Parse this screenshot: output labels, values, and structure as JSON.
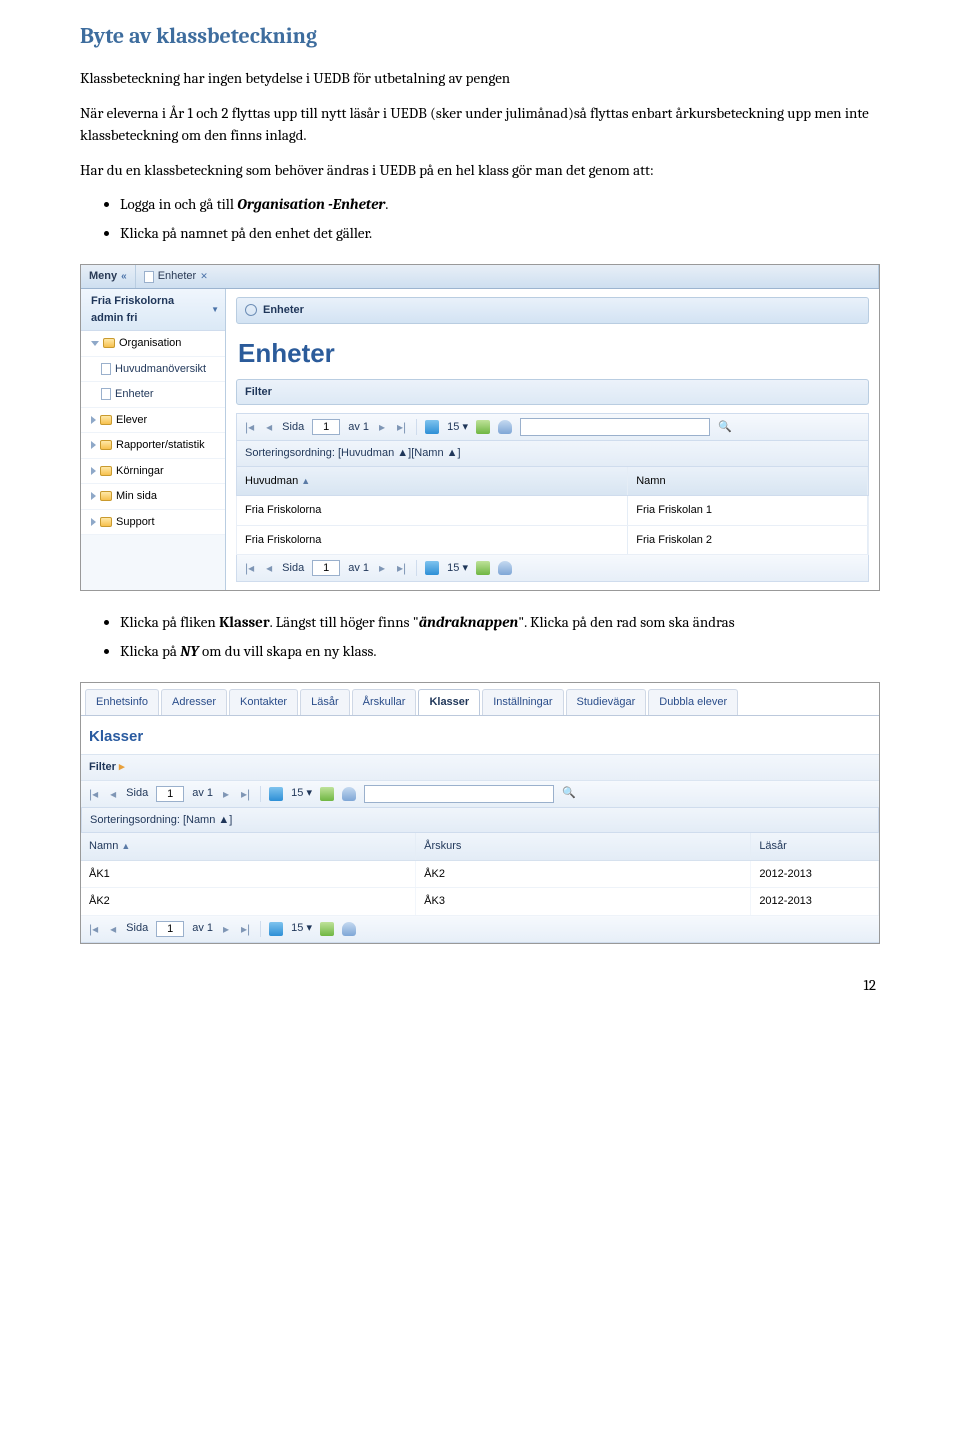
{
  "doc": {
    "heading": "Byte av klassbeteckning",
    "p1": "Klassbeteckning har ingen betydelse i UEDB för utbetalning av pengen",
    "p2a": "När eleverna i År 1 och 2 flyttas upp till nytt läsår i UEDB (sker under julimånad)så flyttas enbart årkursbeteckning upp men inte klassbeteckning om den finns inlagd.",
    "p3": "Har du en klassbeteckning som behöver ändras i UEDB på en hel klass gör man det genom att:",
    "b1a": "Logga in och gå till ",
    "b1b": "Organisation -Enheter",
    "b1c": ".",
    "b2": "Klicka på namnet på den enhet det gäller.",
    "c1a": "Klicka på fliken ",
    "c1b": "Klasser",
    "c1c": ". Längst till höger finns \"",
    "c1d": "ändraknappen",
    "c1e": "\". Klicka på den rad som ska ändras",
    "c2a": "Klicka på ",
    "c2b": "NY",
    "c2c": " om du vill skapa en ny klass.",
    "page": "12"
  },
  "s1": {
    "meny": "Meny",
    "tab": "Enheter",
    "user": "Fria Friskolorna admin fri",
    "side": {
      "org": "Organisation",
      "huvud": "Huvudmanöversikt",
      "enheter": "Enheter",
      "elever": "Elever",
      "rapport": "Rapporter/statistik",
      "korn": "Körningar",
      "minsida": "Min sida",
      "support": "Support"
    },
    "panel": "Enheter",
    "title": "Enheter",
    "filter": "Filter",
    "sida": "Sida",
    "av": "av 1",
    "perpage": "15",
    "sort": "Sorteringsordning: [Huvudman ▲][Namn ▲]",
    "col_huvudman": "Huvudman",
    "col_namn": "Namn",
    "rows": [
      {
        "h": "Fria Friskolorna",
        "n": "Fria Friskolan 1"
      },
      {
        "h": "Fria Friskolorna",
        "n": "Fria Friskolan 2"
      }
    ],
    "page_value": "1"
  },
  "s2": {
    "tabs": [
      "Enhetsinfo",
      "Adresser",
      "Kontakter",
      "Läsår",
      "Årskullar",
      "Klasser",
      "Inställningar",
      "Studievägar",
      "Dubbla elever"
    ],
    "active": "Klasser",
    "title": "Klasser",
    "filter": "Filter",
    "sida": "Sida",
    "av": "av 1",
    "perpage": "15",
    "sort": "Sorteringsordning: [Namn ▲]",
    "cols": {
      "namn": "Namn",
      "arskurs": "Årskurs",
      "lasar": "Läsår"
    },
    "rows": [
      {
        "n": "ÅK1",
        "a": "ÅK2",
        "l": "2012-2013"
      },
      {
        "n": "ÅK2",
        "a": "ÅK3",
        "l": "2012-2013"
      }
    ],
    "page_value": "1"
  }
}
